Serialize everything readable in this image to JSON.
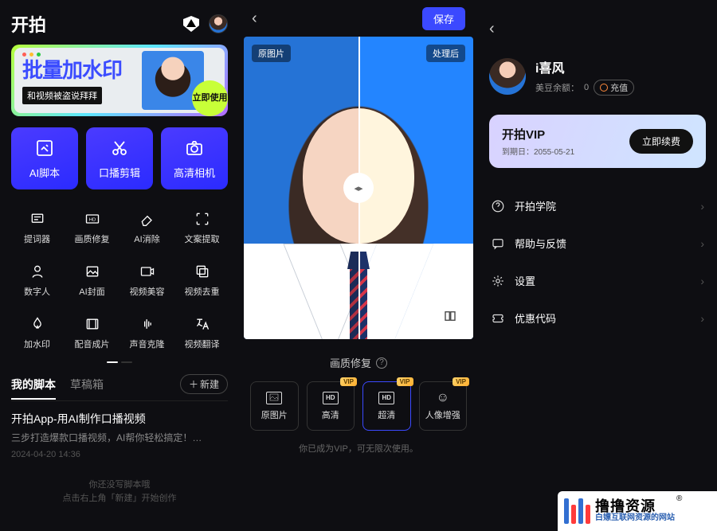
{
  "left": {
    "title": "开拍",
    "banner": {
      "title_plain": "批量加",
      "title_accent": "水印",
      "subtitle": "和视频被盗说拜拜",
      "cta": "立即使用"
    },
    "primary": [
      {
        "name": "ai-script",
        "label": "AI脚本"
      },
      {
        "name": "voice-clip",
        "label": "口播剪辑"
      },
      {
        "name": "hd-camera",
        "label": "高清相机"
      }
    ],
    "grid": [
      {
        "name": "teleprompter",
        "label": "提词器"
      },
      {
        "name": "quality-repair",
        "label": "画质修复"
      },
      {
        "name": "ai-erase",
        "label": "AI消除"
      },
      {
        "name": "text-extract",
        "label": "文案提取"
      },
      {
        "name": "digital-human",
        "label": "数字人"
      },
      {
        "name": "ai-cover",
        "label": "AI封面"
      },
      {
        "name": "video-beauty",
        "label": "视频美容"
      },
      {
        "name": "dedup",
        "label": "视频去重"
      },
      {
        "name": "watermark",
        "label": "加水印"
      },
      {
        "name": "dubbing",
        "label": "配音成片"
      },
      {
        "name": "voice-clone",
        "label": "声音克隆"
      },
      {
        "name": "video-trans",
        "label": "视频翻译"
      }
    ],
    "tabs": {
      "scripts": "我的脚本",
      "drafts": "草稿箱",
      "new": "新建"
    },
    "card": {
      "title": "开拍App-用AI制作口播视频",
      "desc": "三步打造爆款口播视频，AI帮你轻松搞定！…",
      "time": "2024-04-20 14:36"
    },
    "empty": {
      "l1": "你还没写脚本哦",
      "l2": "点击右上角「新建」开始创作"
    }
  },
  "mid": {
    "save": "保存",
    "tag_before": "原图片",
    "tag_after": "处理后",
    "section": "画质修复",
    "options": [
      {
        "name": "opt-original",
        "label": "原图片",
        "vip": false,
        "icon": ""
      },
      {
        "name": "opt-hd",
        "label": "高清",
        "vip": true,
        "icon": "HD"
      },
      {
        "name": "opt-uhd",
        "label": "超清",
        "vip": true,
        "icon": "HD",
        "active": true
      },
      {
        "name": "opt-portrait",
        "label": "人像增强",
        "vip": true,
        "icon": "☺"
      }
    ],
    "footer": "你已成为VIP，可无限次使用。"
  },
  "right": {
    "user": {
      "name": "i喜风",
      "balance_label": "美豆余额：",
      "balance": "0",
      "topup": "充值"
    },
    "vip": {
      "title": "开拍VIP",
      "expire_label": "到期日：",
      "expire": "2055-05-21",
      "renew": "立即续费"
    },
    "menu": [
      {
        "name": "menu-academy",
        "label": "开拍学院"
      },
      {
        "name": "menu-feedback",
        "label": "帮助与反馈"
      },
      {
        "name": "menu-settings",
        "label": "设置"
      },
      {
        "name": "menu-coupon",
        "label": "优惠代码"
      }
    ]
  },
  "watermark": {
    "big": "撸撸资源",
    "small": "白嫖互联网资源的网站"
  }
}
